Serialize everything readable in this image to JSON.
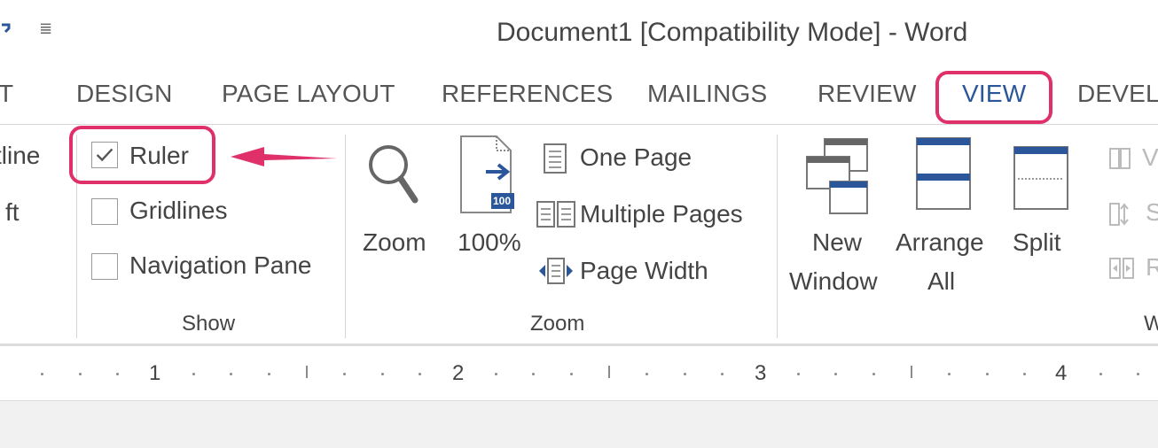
{
  "window": {
    "title": "Document1 [Compatibility Mode] - Word",
    "qat_more_glyph": "≣"
  },
  "tabs": [
    {
      "label": "T"
    },
    {
      "label": "DESIGN"
    },
    {
      "label": "PAGE LAYOUT"
    },
    {
      "label": "REFERENCES"
    },
    {
      "label": "MAILINGS"
    },
    {
      "label": "REVIEW"
    },
    {
      "label": "VIEW",
      "active": true
    },
    {
      "label": "DEVEL"
    }
  ],
  "views_group": {
    "outline_partial": "tline",
    "draft_partial": "ft"
  },
  "show_group": {
    "label": "Show",
    "ruler": {
      "label": "Ruler",
      "checked": true
    },
    "gridlines": {
      "label": "Gridlines",
      "checked": false
    },
    "navigation_pane": {
      "label": "Navigation Pane",
      "checked": false
    }
  },
  "zoom_group": {
    "label": "Zoom",
    "zoom_button": "Zoom",
    "hundred_button": "100%",
    "hundred_badge": "100",
    "one_page": "One Page",
    "multiple_pages": "Multiple Pages",
    "page_width": "Page Width"
  },
  "window_group": {
    "label_partial": "W",
    "new_window_line1": "New",
    "new_window_line2": "Window",
    "arrange_all_line1": "Arrange",
    "arrange_all_line2": "All",
    "split": "Split",
    "view_side_partial": "V",
    "sync_partial": "S",
    "reset_partial": "R"
  },
  "ruler": {
    "numbers": [
      "1",
      "2",
      "3",
      "4"
    ]
  },
  "colors": {
    "accent": "#2b579a",
    "highlight": "#e0306a",
    "text": "#444444"
  }
}
